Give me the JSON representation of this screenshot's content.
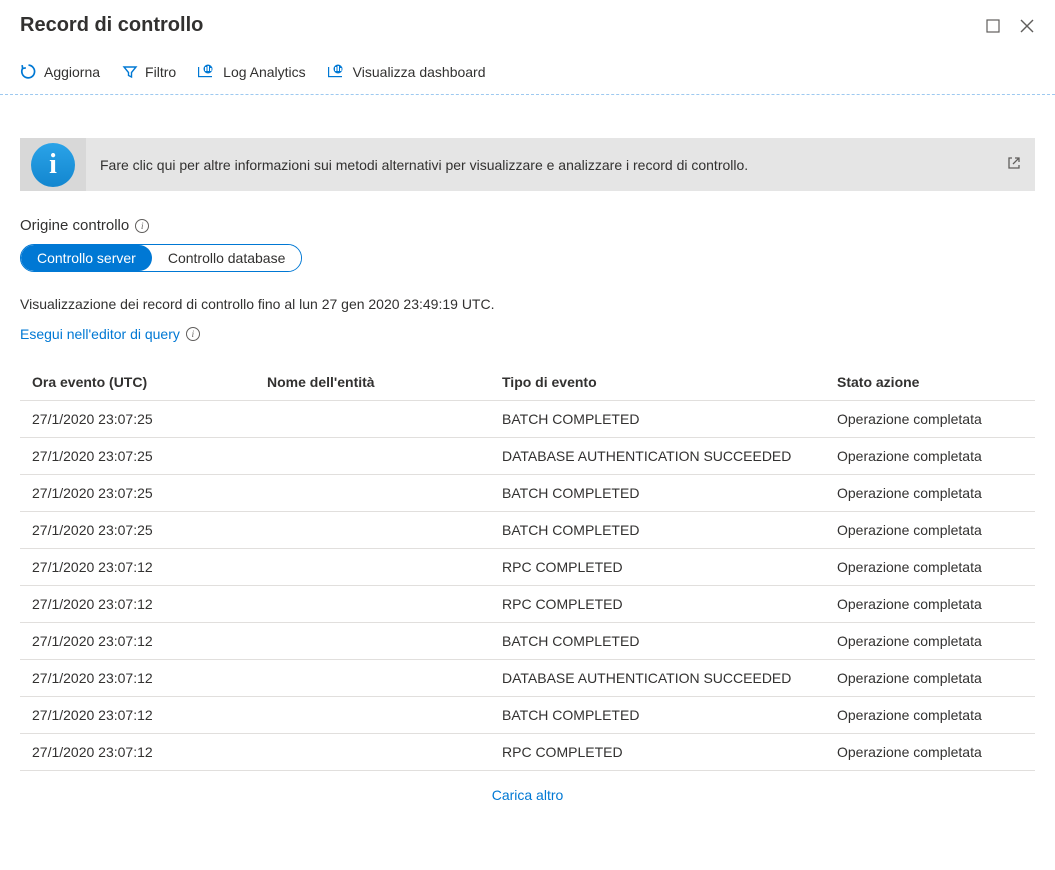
{
  "header": {
    "title": "Record di controllo"
  },
  "toolbar": {
    "refresh": "Aggiorna",
    "filter": "Filtro",
    "logAnalytics": "Log Analytics",
    "viewDashboard": "Visualizza dashboard"
  },
  "banner": {
    "text": "Fare clic qui per altre informazioni sui metodi alternativi per visualizzare e analizzare i record di controllo."
  },
  "source": {
    "label": "Origine controllo",
    "toggle": {
      "server": "Controllo server",
      "database": "Controllo database"
    }
  },
  "status": {
    "recordsUntil": "Visualizzazione dei record di controllo fino al lun 27 gen 2020 23:49:19 UTC."
  },
  "queryLink": "Esegui nell'editor di query",
  "table": {
    "headers": {
      "eventTime": "Ora evento (UTC)",
      "entityName": "Nome dell'entità",
      "eventType": "Tipo di evento",
      "actionState": "Stato azione"
    },
    "rows": [
      {
        "time": "27/1/2020 23:07:25",
        "entity": "",
        "type": "BATCH COMPLETED",
        "state": "Operazione completata"
      },
      {
        "time": "27/1/2020 23:07:25",
        "entity": "",
        "type": "DATABASE AUTHENTICATION SUCCEEDED",
        "state": "Operazione completata"
      },
      {
        "time": "27/1/2020 23:07:25",
        "entity": "",
        "type": "BATCH COMPLETED",
        "state": "Operazione completata"
      },
      {
        "time": "27/1/2020 23:07:25",
        "entity": "",
        "type": "BATCH COMPLETED",
        "state": "Operazione completata"
      },
      {
        "time": "27/1/2020 23:07:12",
        "entity": "",
        "type": "RPC COMPLETED",
        "state": "Operazione completata"
      },
      {
        "time": "27/1/2020 23:07:12",
        "entity": "",
        "type": "RPC COMPLETED",
        "state": "Operazione completata"
      },
      {
        "time": "27/1/2020 23:07:12",
        "entity": "",
        "type": "BATCH COMPLETED",
        "state": "Operazione completata"
      },
      {
        "time": "27/1/2020 23:07:12",
        "entity": "",
        "type": "DATABASE AUTHENTICATION SUCCEEDED",
        "state": "Operazione completata"
      },
      {
        "time": "27/1/2020 23:07:12",
        "entity": "",
        "type": "BATCH COMPLETED",
        "state": "Operazione completata"
      },
      {
        "time": "27/1/2020 23:07:12",
        "entity": "",
        "type": "RPC COMPLETED",
        "state": "Operazione completata"
      }
    ]
  },
  "loadMore": "Carica altro"
}
